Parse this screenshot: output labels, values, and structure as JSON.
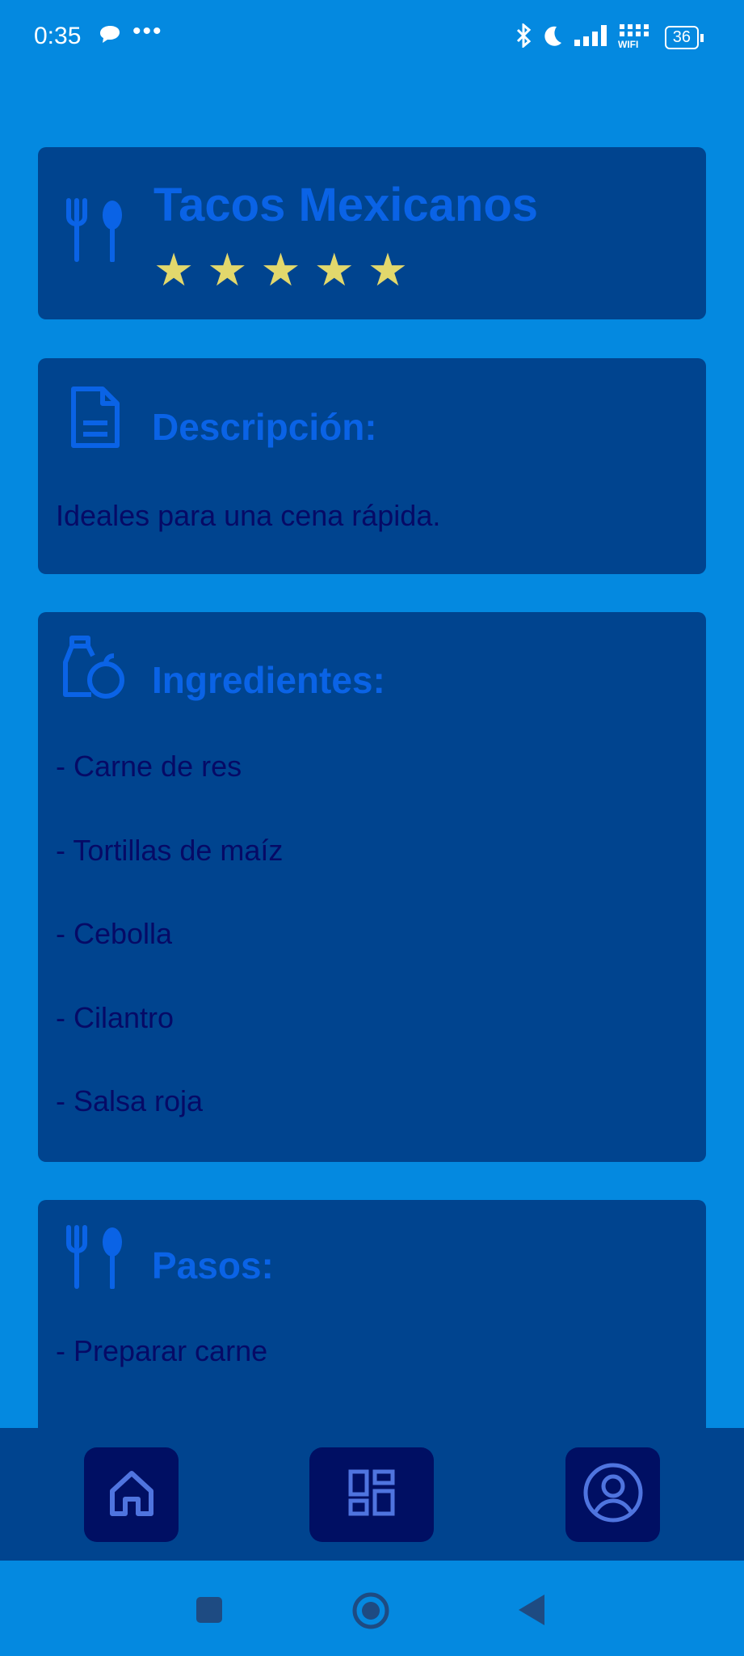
{
  "status_bar": {
    "time": "0:35",
    "more": "•••",
    "battery": "36"
  },
  "recipe": {
    "title": "Tacos Mexicanos",
    "rating": 5,
    "rating_max": 5
  },
  "description": {
    "heading": "Descripción:",
    "text": "Ideales para una cena rápida."
  },
  "ingredients": {
    "heading": "Ingredientes:",
    "items": [
      "- Carne de res",
      "- Tortillas de maíz",
      "- Cebolla",
      "- Cilantro",
      "- Salsa roja"
    ]
  },
  "steps": {
    "heading": "Pasos:",
    "items": [
      "- Preparar carne"
    ]
  },
  "bottom_nav": {
    "items": [
      "home-icon",
      "dashboard-icon",
      "profile-icon"
    ]
  },
  "system_nav": {
    "items": [
      "recents-button",
      "home-button",
      "back-button"
    ]
  },
  "colors": {
    "background": "#0489e0",
    "card": "#00448f",
    "title": "#0a63e6",
    "text": "#060a66",
    "star": "#e2d86c",
    "nav_button": "#000f63"
  }
}
